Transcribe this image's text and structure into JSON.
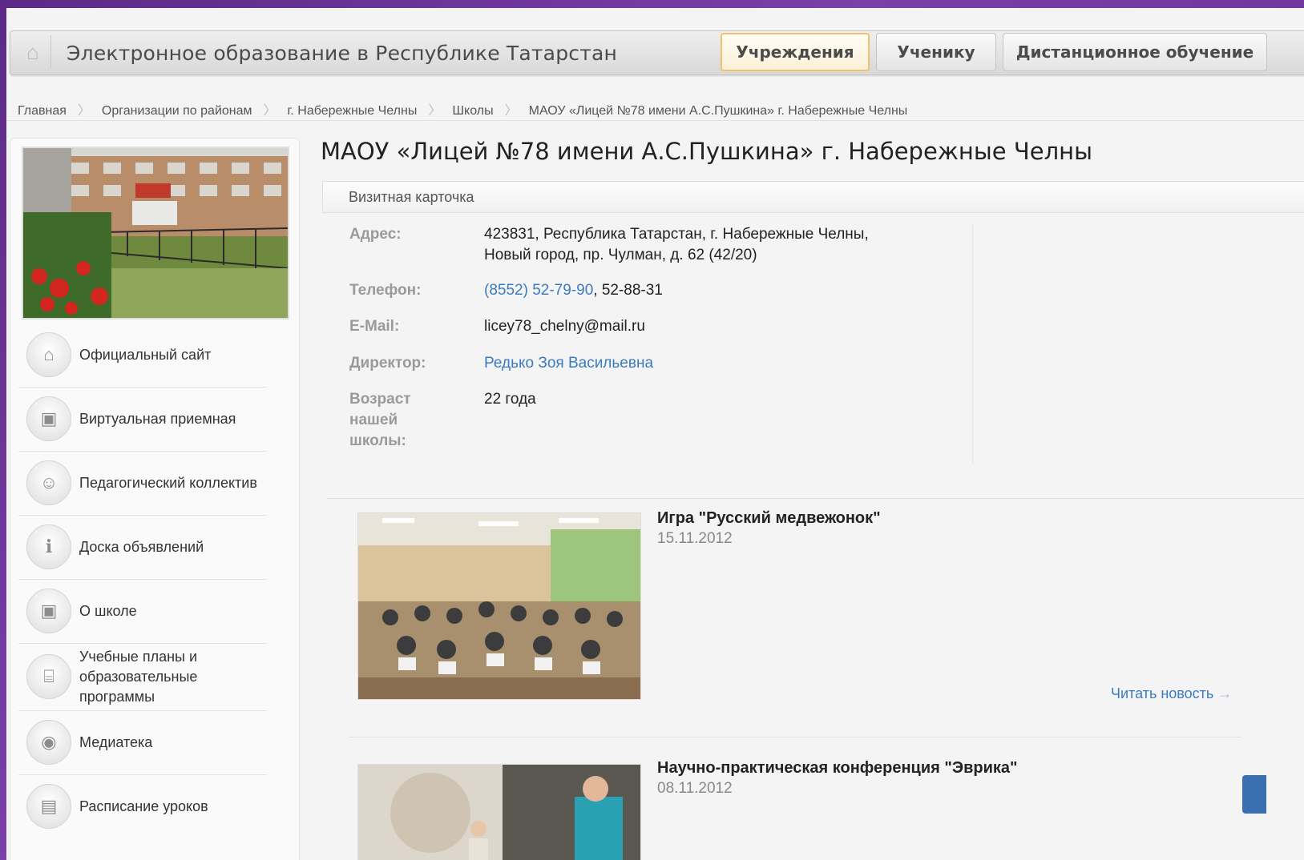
{
  "header": {
    "site_title": "Электронное образование в Республике Татарстан",
    "tabs": [
      {
        "label": "Учреждения",
        "active": true
      },
      {
        "label": "Ученику",
        "active": false
      },
      {
        "label": "Дистанционное обучение",
        "active": false
      }
    ],
    "home_icon": "home-icon"
  },
  "breadcrumb": [
    "Главная",
    "Организации по районам",
    "г. Набережные Челны",
    "Школы",
    "МАОУ «Лицей №78 имени А.С.Пушкина» г. Набережные Челны"
  ],
  "sidebar": {
    "items": [
      {
        "label": "Официальный сайт",
        "icon": "website-icon"
      },
      {
        "label": "Виртуальная приемная",
        "icon": "reception-icon"
      },
      {
        "label": "Педагогический коллектив",
        "icon": "staff-icon"
      },
      {
        "label": "Доска объявлений",
        "icon": "info-icon"
      },
      {
        "label": "О школе",
        "icon": "about-icon"
      },
      {
        "label": "Учебные планы и образовательные программы",
        "icon": "building-icon"
      },
      {
        "label": "Медиатека",
        "icon": "media-icon"
      },
      {
        "label": "Расписание уроков",
        "icon": "schedule-icon"
      }
    ]
  },
  "main": {
    "title": "МАОУ «Лицей №78 имени А.С.Пушкина» г. Набережные Челны",
    "card_header": "Визитная карточка",
    "info": {
      "address_label": "Адрес:",
      "address_line1": "423831, Республика Татарстан, г. Набережные Челны,",
      "address_line2": "Новый город, пр. Чулман, д. 62 (42/20)",
      "phone_label": "Телефон:",
      "phone_link": "(8552) 52-79-90",
      "phone_rest": ", 52-88-31",
      "email_label": "E-Mail:",
      "email": "licey78_chelny@mail.ru",
      "director_label": "Директор:",
      "director": "Редько Зоя Васильевна",
      "age_label_1": "Возраст",
      "age_label_2": "нашей",
      "age_label_3": "школы:",
      "age": "22 года"
    },
    "news": [
      {
        "title": "Игра \"Русский медвежонок\"",
        "date": "15.11.2012"
      },
      {
        "title": "Научно-практическая конференция \"Эврика\"",
        "date": "08.11.2012"
      }
    ],
    "read_more": "Читать новость"
  },
  "colors": {
    "link": "#3b7bbf",
    "active_tab_border": "#f0c36a",
    "frame_bg": "#5b2a86"
  }
}
